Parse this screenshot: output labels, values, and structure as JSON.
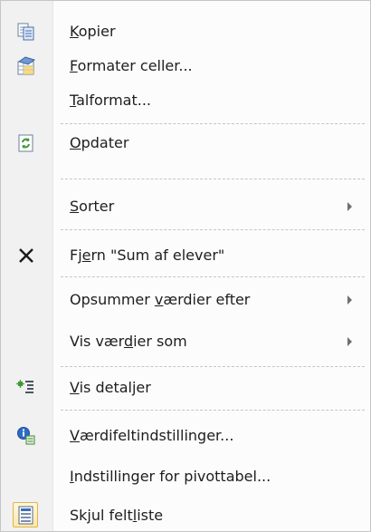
{
  "menu": {
    "items": [
      {
        "pre": "",
        "key": "K",
        "post": "opier",
        "icon": "copy-icon",
        "submenu": false
      },
      {
        "pre": "",
        "key": "F",
        "post": "ormater celler...",
        "icon": "format-cells-icon",
        "submenu": false
      },
      {
        "pre": "",
        "key": "T",
        "post": "alformat...",
        "icon": "",
        "submenu": false
      },
      {
        "pre": "",
        "key": "O",
        "post": "pdater",
        "icon": "refresh-icon",
        "submenu": false
      },
      {
        "pre": "",
        "key": "S",
        "post": "orter",
        "icon": "",
        "submenu": true
      },
      {
        "pre": "Fj",
        "key": "e",
        "post": "rn \"Sum af elever\"",
        "icon": "remove-x-icon",
        "submenu": false
      },
      {
        "pre": "Opsummer ",
        "key": "v",
        "post": "ærdier efter",
        "icon": "",
        "submenu": true
      },
      {
        "pre": "Vis vær",
        "key": "d",
        "post": "ier som",
        "icon": "",
        "submenu": true
      },
      {
        "pre": "",
        "key": "V",
        "post": "is detaljer",
        "icon": "show-details-icon",
        "submenu": false
      },
      {
        "pre": "",
        "key": "V",
        "post": "ærdifeltindstillinger...",
        "icon": "value-field-settings-icon",
        "submenu": false
      },
      {
        "pre": "",
        "key": "I",
        "post": "ndstillinger for pivottabel...",
        "icon": "",
        "submenu": false
      },
      {
        "pre": "Skjul felt",
        "key": "l",
        "post": "iste",
        "icon": "field-list-icon",
        "submenu": false,
        "checked": true
      }
    ]
  }
}
